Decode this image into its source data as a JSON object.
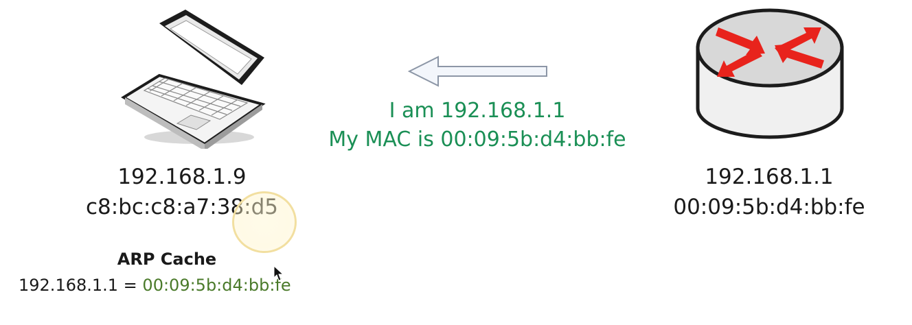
{
  "laptop": {
    "icon": "laptop-icon",
    "ip": "192.168.1.9",
    "mac": "c8:bc:c8:a7:38:d5"
  },
  "router": {
    "icon": "router-icon",
    "ip": "192.168.1.1",
    "mac": "00:09:5b:d4:bb:fe"
  },
  "message": {
    "arrow_icon": "arrow-left-icon",
    "line1": "I am 192.168.1.1",
    "line2": "My MAC is 00:09:5b:d4:bb:fe"
  },
  "arp_cache": {
    "title": "ARP Cache",
    "entry_ip": "192.168.1.1",
    "entry_separator": " = ",
    "entry_mac": "00:09:5b:d4:bb:fe"
  },
  "colors": {
    "message_text": "#1a8f55",
    "arp_mac_text": "#4a7a2a",
    "router_arrows": "#e8231c",
    "highlight_ring": "#f2dfa0"
  }
}
